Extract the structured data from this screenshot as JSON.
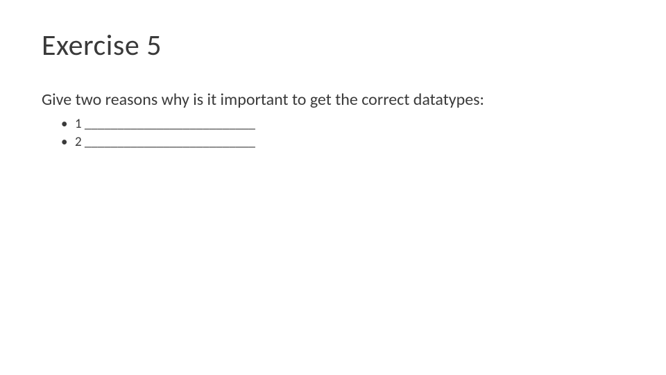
{
  "slide": {
    "title": "Exercise 5",
    "prompt": "Give two reasons why is it important to get the correct datatypes:",
    "bullets": [
      "1 __________________________",
      "2 __________________________"
    ]
  }
}
